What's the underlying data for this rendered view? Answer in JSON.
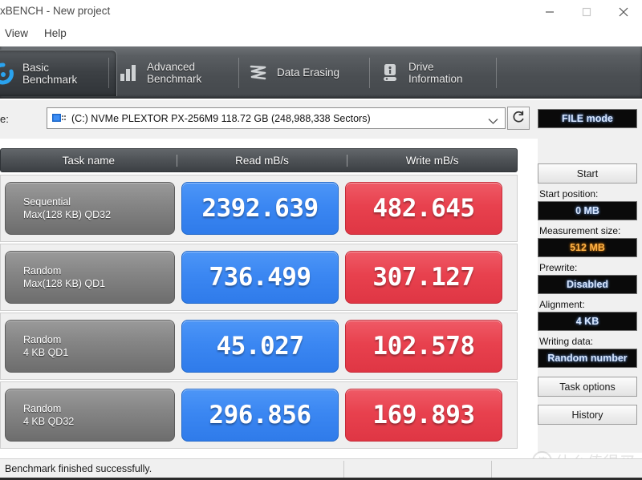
{
  "window": {
    "title": "xBENCH - New project",
    "controls": {
      "minimize": "minimize-button",
      "maximize": "maximize-button",
      "close": "close-button"
    }
  },
  "menubar": {
    "items": [
      {
        "label": "View"
      },
      {
        "label": "Help"
      }
    ]
  },
  "tabs": [
    {
      "label_line1": "Basic",
      "label_line2": "Benchmark",
      "icon": "speedometer-icon",
      "active": true
    },
    {
      "label_line1": "Advanced",
      "label_line2": "Benchmark",
      "icon": "bar-chart-icon",
      "active": false
    },
    {
      "label_line1": "Data Erasing",
      "label_line2": "",
      "icon": "shredder-icon",
      "active": false
    },
    {
      "label_line1": "Drive",
      "label_line2": "Information",
      "icon": "drive-info-icon",
      "active": false
    }
  ],
  "drive_selector": {
    "label": "e:",
    "value": "(C:) NVMe PLEXTOR PX-256M9  118.72 GB (248,988,338 Sectors)",
    "dropdown_icon": "chevron-down-icon",
    "refresh_icon": "refresh-icon"
  },
  "table": {
    "headers": {
      "task": "Task name",
      "read": "Read mB/s",
      "write": "Write mB/s"
    },
    "rows": [
      {
        "name_line1": "Sequential",
        "name_line2": "Max(128 KB) QD32",
        "read": "2392.639",
        "write": "482.645"
      },
      {
        "name_line1": "Random",
        "name_line2": "Max(128 KB) QD1",
        "read": "736.499",
        "write": "307.127"
      },
      {
        "name_line1": "Random",
        "name_line2": "4 KB QD1",
        "read": "45.027",
        "write": "102.578"
      },
      {
        "name_line1": "Random",
        "name_line2": "4 KB QD32",
        "read": "296.856",
        "write": "169.893"
      }
    ]
  },
  "side_panel": {
    "mode": "FILE mode",
    "start_button": "Start",
    "start_position_label": "Start position:",
    "start_position_value": "0 MB",
    "measurement_size_label": "Measurement size:",
    "measurement_size_value": "512 MB",
    "prewrite_label": "Prewrite:",
    "prewrite_value": "Disabled",
    "alignment_label": "Alignment:",
    "alignment_value": "4 KB",
    "writing_data_label": "Writing data:",
    "writing_data_value": "Random number",
    "task_options_button": "Task options",
    "history_button": "History"
  },
  "statusbar": {
    "message": "Benchmark finished successfully."
  },
  "watermark": {
    "badge": "值",
    "text": "什么值得买"
  },
  "colors": {
    "read_accent": "#3b87f2",
    "write_accent": "#e8414e",
    "tab_bar": "#4b4f53",
    "lcd_background": "#0a0a0a",
    "lcd_cyan_text": "#d7e6ff",
    "lcd_orange_text": "#ffb347"
  }
}
